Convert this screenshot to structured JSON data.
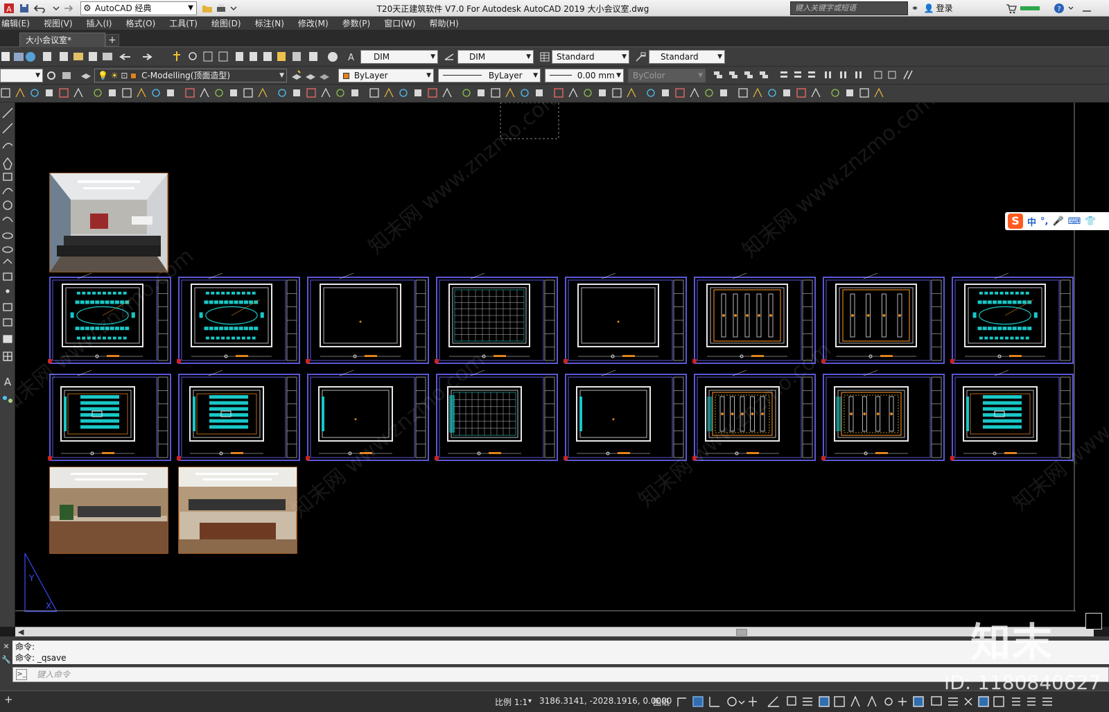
{
  "titlebar": {
    "workspace": "AutoCAD 经典",
    "title": "T20天正建筑软件 V7.0 For Autodesk AutoCAD 2019    大小会议室.dwg",
    "search_placeholder": "键入关键字或短语",
    "login": "登录"
  },
  "menus": [
    "编辑(E)",
    "视图(V)",
    "插入(I)",
    "格式(O)",
    "工具(T)",
    "绘图(D)",
    "标注(N)",
    "修改(M)",
    "参数(P)",
    "窗口(W)",
    "帮助(H)"
  ],
  "tabs": {
    "document": "大小会议室*",
    "new_tab": "+"
  },
  "toolbar_styles": {
    "text_style": "DIM",
    "dim_style": "DIM",
    "table_style": "Standard",
    "multileader_style": "Standard"
  },
  "toolbar_layers": {
    "layer": "C-Modelling(顶面造型)",
    "color": "ByLayer",
    "linetype": "ByLayer",
    "lineweight": "0.00 mm",
    "plotstyle": "ByColor"
  },
  "ime": {
    "mode": "中"
  },
  "command": {
    "line1": "命令:",
    "line2": "命令: _qsave",
    "input_placeholder": "键入命令"
  },
  "status": {
    "scale": "比例 1:1",
    "coords": "3186.3141, -2028.1916, 0.0000",
    "paper": "图纸"
  },
  "watermark": {
    "brand": "知末",
    "diag": "知末网 www.znzmo.com",
    "id": "ID: 1180840627"
  },
  "colors": {
    "canvas": "#000000",
    "sheet_border": "#5a58d6",
    "cad_cyan": "#19c7c7",
    "cad_orange": "#e0821e",
    "cad_white": "#e8e8e8"
  }
}
